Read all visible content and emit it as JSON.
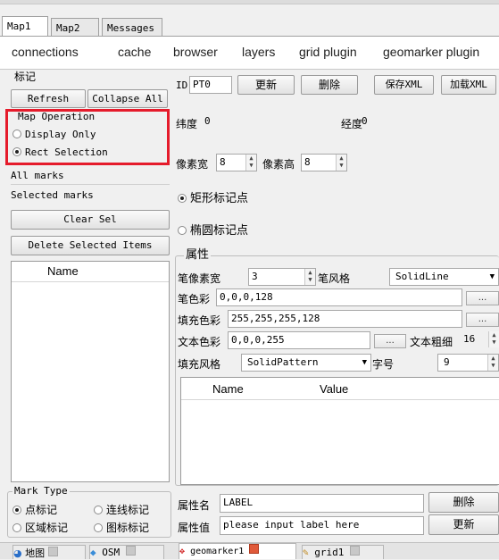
{
  "top_tabs": [
    "Map1",
    "Map2",
    "Messages"
  ],
  "sub_tabs": [
    "connections",
    "cache",
    "browser",
    "layers",
    "grid plugin",
    "geomarker plugin"
  ],
  "left": {
    "group_title": "标记",
    "refresh": "Refresh",
    "collapse": "Collapse All",
    "map_op_title": "Map Operation",
    "display_only": "Display Only",
    "rect_selection": "Rect Selection",
    "all_marks": "All marks",
    "selected_marks": "Selected marks",
    "clear_sel": "Clear Sel",
    "delete_selected": "Delete Selected  Items",
    "name_header": "Name",
    "mark_type_title": "Mark Type",
    "point_mark": "点标记",
    "line_mark": "连线标记",
    "region_mark": "区域标记",
    "icon_mark": "图标标记"
  },
  "right": {
    "id_label": "ID",
    "id_value": "PT0",
    "update_btn": "更新",
    "delete_btn": "删除",
    "save_xml": "保存XML",
    "load_xml": "加载XML",
    "lat_label": "纬度",
    "lat_value": "0",
    "lon_label": "经度",
    "lon_value": "0",
    "px_width_label": "像素宽",
    "px_width_value": "8",
    "px_height_label": "像素高",
    "px_height_value": "8",
    "rect_mark": "矩形标记点",
    "ellipse_mark": "椭圆标记点",
    "attr_title": "属性",
    "pen_width_label": "笔像素宽",
    "pen_width_value": "3",
    "pen_style_label": "笔风格",
    "pen_style_value": "SolidLine",
    "pen_color_label": "笔色彩",
    "pen_color_value": "0,0,0,128",
    "fill_color_label": "填充色彩",
    "fill_color_value": "255,255,255,128",
    "text_color_label": "文本色彩",
    "text_color_value": "0,0,0,255",
    "text_weight_label": "文本粗细",
    "text_weight_value": "16",
    "fill_style_label": "填充风格",
    "fill_style_value": "SolidPattern",
    "font_size_label": "字号",
    "font_size_value": "9",
    "table_name": "Name",
    "table_value": "Value",
    "prop_name_label": "属性名",
    "prop_name_value": "LABEL",
    "prop_delete": "删除",
    "prop_value_label": "属性值",
    "prop_value_value": "please input label here",
    "prop_update": "更新",
    "ellipsis": "..."
  },
  "bottom_tabs": [
    "地图",
    "OSM",
    "geomarker1",
    "grid1"
  ],
  "colors": {
    "highlight_box": "#e51b2b"
  }
}
